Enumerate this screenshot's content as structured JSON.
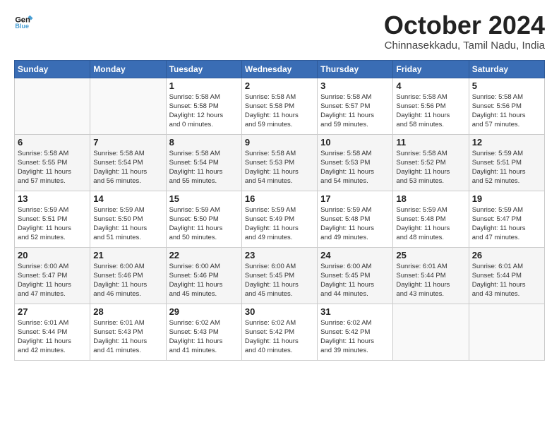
{
  "header": {
    "logo_line1": "General",
    "logo_line2": "Blue",
    "month": "October 2024",
    "location": "Chinnasekkadu, Tamil Nadu, India"
  },
  "days_of_week": [
    "Sunday",
    "Monday",
    "Tuesday",
    "Wednesday",
    "Thursday",
    "Friday",
    "Saturday"
  ],
  "weeks": [
    [
      {
        "day": "",
        "info": ""
      },
      {
        "day": "",
        "info": ""
      },
      {
        "day": "1",
        "info": "Sunrise: 5:58 AM\nSunset: 5:58 PM\nDaylight: 12 hours\nand 0 minutes."
      },
      {
        "day": "2",
        "info": "Sunrise: 5:58 AM\nSunset: 5:58 PM\nDaylight: 11 hours\nand 59 minutes."
      },
      {
        "day": "3",
        "info": "Sunrise: 5:58 AM\nSunset: 5:57 PM\nDaylight: 11 hours\nand 59 minutes."
      },
      {
        "day": "4",
        "info": "Sunrise: 5:58 AM\nSunset: 5:56 PM\nDaylight: 11 hours\nand 58 minutes."
      },
      {
        "day": "5",
        "info": "Sunrise: 5:58 AM\nSunset: 5:56 PM\nDaylight: 11 hours\nand 57 minutes."
      }
    ],
    [
      {
        "day": "6",
        "info": "Sunrise: 5:58 AM\nSunset: 5:55 PM\nDaylight: 11 hours\nand 57 minutes."
      },
      {
        "day": "7",
        "info": "Sunrise: 5:58 AM\nSunset: 5:54 PM\nDaylight: 11 hours\nand 56 minutes."
      },
      {
        "day": "8",
        "info": "Sunrise: 5:58 AM\nSunset: 5:54 PM\nDaylight: 11 hours\nand 55 minutes."
      },
      {
        "day": "9",
        "info": "Sunrise: 5:58 AM\nSunset: 5:53 PM\nDaylight: 11 hours\nand 54 minutes."
      },
      {
        "day": "10",
        "info": "Sunrise: 5:58 AM\nSunset: 5:53 PM\nDaylight: 11 hours\nand 54 minutes."
      },
      {
        "day": "11",
        "info": "Sunrise: 5:58 AM\nSunset: 5:52 PM\nDaylight: 11 hours\nand 53 minutes."
      },
      {
        "day": "12",
        "info": "Sunrise: 5:59 AM\nSunset: 5:51 PM\nDaylight: 11 hours\nand 52 minutes."
      }
    ],
    [
      {
        "day": "13",
        "info": "Sunrise: 5:59 AM\nSunset: 5:51 PM\nDaylight: 11 hours\nand 52 minutes."
      },
      {
        "day": "14",
        "info": "Sunrise: 5:59 AM\nSunset: 5:50 PM\nDaylight: 11 hours\nand 51 minutes."
      },
      {
        "day": "15",
        "info": "Sunrise: 5:59 AM\nSunset: 5:50 PM\nDaylight: 11 hours\nand 50 minutes."
      },
      {
        "day": "16",
        "info": "Sunrise: 5:59 AM\nSunset: 5:49 PM\nDaylight: 11 hours\nand 49 minutes."
      },
      {
        "day": "17",
        "info": "Sunrise: 5:59 AM\nSunset: 5:48 PM\nDaylight: 11 hours\nand 49 minutes."
      },
      {
        "day": "18",
        "info": "Sunrise: 5:59 AM\nSunset: 5:48 PM\nDaylight: 11 hours\nand 48 minutes."
      },
      {
        "day": "19",
        "info": "Sunrise: 5:59 AM\nSunset: 5:47 PM\nDaylight: 11 hours\nand 47 minutes."
      }
    ],
    [
      {
        "day": "20",
        "info": "Sunrise: 6:00 AM\nSunset: 5:47 PM\nDaylight: 11 hours\nand 47 minutes."
      },
      {
        "day": "21",
        "info": "Sunrise: 6:00 AM\nSunset: 5:46 PM\nDaylight: 11 hours\nand 46 minutes."
      },
      {
        "day": "22",
        "info": "Sunrise: 6:00 AM\nSunset: 5:46 PM\nDaylight: 11 hours\nand 45 minutes."
      },
      {
        "day": "23",
        "info": "Sunrise: 6:00 AM\nSunset: 5:45 PM\nDaylight: 11 hours\nand 45 minutes."
      },
      {
        "day": "24",
        "info": "Sunrise: 6:00 AM\nSunset: 5:45 PM\nDaylight: 11 hours\nand 44 minutes."
      },
      {
        "day": "25",
        "info": "Sunrise: 6:01 AM\nSunset: 5:44 PM\nDaylight: 11 hours\nand 43 minutes."
      },
      {
        "day": "26",
        "info": "Sunrise: 6:01 AM\nSunset: 5:44 PM\nDaylight: 11 hours\nand 43 minutes."
      }
    ],
    [
      {
        "day": "27",
        "info": "Sunrise: 6:01 AM\nSunset: 5:44 PM\nDaylight: 11 hours\nand 42 minutes."
      },
      {
        "day": "28",
        "info": "Sunrise: 6:01 AM\nSunset: 5:43 PM\nDaylight: 11 hours\nand 41 minutes."
      },
      {
        "day": "29",
        "info": "Sunrise: 6:02 AM\nSunset: 5:43 PM\nDaylight: 11 hours\nand 41 minutes."
      },
      {
        "day": "30",
        "info": "Sunrise: 6:02 AM\nSunset: 5:42 PM\nDaylight: 11 hours\nand 40 minutes."
      },
      {
        "day": "31",
        "info": "Sunrise: 6:02 AM\nSunset: 5:42 PM\nDaylight: 11 hours\nand 39 minutes."
      },
      {
        "day": "",
        "info": ""
      },
      {
        "day": "",
        "info": ""
      }
    ]
  ]
}
